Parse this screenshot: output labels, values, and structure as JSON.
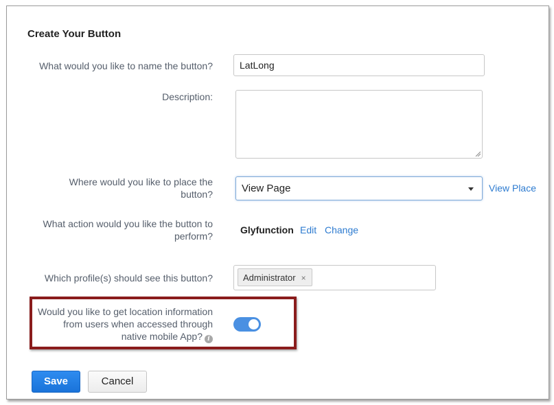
{
  "form": {
    "title": "Create Your Button",
    "name": {
      "label": "What would you like to name the button?",
      "value": "LatLong"
    },
    "description": {
      "label": "Description:",
      "value": ""
    },
    "placement": {
      "label": "Where would you like to place the button?",
      "selected": "View Page",
      "link": "View Place"
    },
    "action": {
      "label": "What action would you like the button to perform?",
      "value": "Glyfunction",
      "edit_link": "Edit",
      "change_link": "Change"
    },
    "profiles": {
      "label": "Which profile(s) should see this button?",
      "chips": [
        "Administrator"
      ],
      "remove_glyph": "×"
    },
    "location": {
      "label": "Would you like to get location information from users when accessed through native mobile App?",
      "info_glyph": "i",
      "toggle_on": true
    }
  },
  "buttons": {
    "save": "Save",
    "cancel": "Cancel"
  },
  "colors": {
    "accent": "#1a73d9",
    "link": "#2d7bd0",
    "toggle_on": "#4a90e2",
    "highlight_border": "#8a1c1c"
  },
  "icons": {
    "dropdown": "chevron-down-icon",
    "info": "info-icon",
    "chip_remove": "close-icon",
    "textarea_resize": "resize-grip-icon"
  }
}
